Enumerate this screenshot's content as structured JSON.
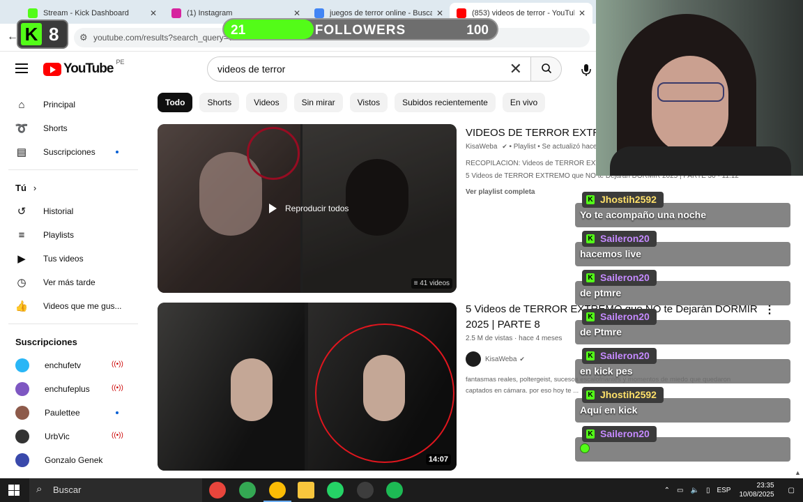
{
  "browser": {
    "tabs": [
      {
        "title": "Stream - Kick Dashboard",
        "fav_color": "#53fc18",
        "active": false
      },
      {
        "title": "(1) Instagram",
        "fav_color": "#d6249f",
        "active": false
      },
      {
        "title": "juegos de terror online - Buscar",
        "fav_color": "#4285f4",
        "active": false
      },
      {
        "title": "(853) videos de terror - YouTube",
        "fav_color": "#ff0000",
        "active": true
      }
    ],
    "close_glyph": "✕",
    "url": "youtube.com/results?search_query=videos+de+terror"
  },
  "overlay": {
    "kick_letter": "K",
    "kick_count": "8",
    "followers": {
      "current": "21",
      "label": "FOLLOWERS",
      "goal": "100",
      "progress": 0.21
    }
  },
  "youtube": {
    "logo_word": "YouTube",
    "country": "PE",
    "search_value": "videos de terror",
    "sidebar_main": [
      {
        "label": "Principal",
        "icon": "home-icon",
        "glyph": "⌂"
      },
      {
        "label": "Shorts",
        "icon": "shorts-icon",
        "glyph": "➰"
      },
      {
        "label": "Suscripciones",
        "icon": "subscriptions-icon",
        "glyph": "▤",
        "dot": true
      }
    ],
    "you_label": "Tú",
    "sidebar_you": [
      {
        "label": "Historial",
        "icon": "history-icon",
        "glyph": "↺"
      },
      {
        "label": "Playlists",
        "icon": "playlists-icon",
        "glyph": "≡"
      },
      {
        "label": "Tus videos",
        "icon": "your-videos-icon",
        "glyph": "▶"
      },
      {
        "label": "Ver más tarde",
        "icon": "watch-later-icon",
        "glyph": "◷"
      },
      {
        "label": "Videos que me gus...",
        "icon": "liked-icon",
        "glyph": "👍"
      }
    ],
    "subs_label": "Suscripciones",
    "subscriptions": [
      {
        "label": "enchufetv",
        "color": "#29b6f6",
        "badge": "live"
      },
      {
        "label": "enchufeplus",
        "color": "#7e57c2",
        "badge": "live"
      },
      {
        "label": "Paulettee",
        "color": "#8d5a4a",
        "badge": "dot"
      },
      {
        "label": "UrbVic",
        "color": "#333333",
        "badge": "live"
      },
      {
        "label": "Gonzalo Genek",
        "color": "#3949ab",
        "badge": "none"
      }
    ],
    "live_glyph": "((•))",
    "chips": [
      "Todo",
      "Shorts",
      "Videos",
      "Sin mirar",
      "Vistos",
      "Subidos recientemente",
      "En vivo"
    ],
    "results": [
      {
        "title": "VIDEOS DE TERROR EXTREMO",
        "channel": "KisaWeba",
        "meta": "• Playlist • Se actualizó hace",
        "line1": "RECOPILACIÓN: Videos de TERROR EXTREMO",
        "line2": "5 Videos de TERROR EXTREMO que NO te Dejarán DORMIR 2025 | PARTE 30 · 11:12",
        "link": "Ver playlist completa",
        "play_all": "Reproducir todos",
        "count": "≡ 41 videos"
      },
      {
        "title": "5 Videos de TERROR EXTREMO que NO te Dejarán DORMIR 2025 | PARTE 8",
        "views": "2.5 M de vistas · hace 4 meses",
        "channel": "KisaWeba",
        "desc": "fantasmas reales, poltergeist, sucesos escalofriantes y momentos de miedo que quedaron captados en cámara. por eso hoy te ...",
        "duration": "14:07"
      }
    ]
  },
  "chat": [
    {
      "user": "Jhostih2592",
      "color": "yellow",
      "text": "Yo te acompaño una noche"
    },
    {
      "user": "Saileron20",
      "color": "purple",
      "text": "hacemos live"
    },
    {
      "user": "Saileron20",
      "color": "purple",
      "text": "de ptmre"
    },
    {
      "user": "Saileron20",
      "color": "purple",
      "text": "de Ptmre"
    },
    {
      "user": "Saileron20",
      "color": "purple",
      "text": "en kick pes"
    },
    {
      "user": "Jhostih2592",
      "color": "yellow",
      "text": "Aquí en kick"
    },
    {
      "user": "Saileron20",
      "color": "purple",
      "text": "",
      "emote": true
    }
  ],
  "taskbar": {
    "search_placeholder": "Buscar",
    "apps": [
      {
        "name": "chrome-icon",
        "color": "#e8453c",
        "active": false
      },
      {
        "name": "chrome-icon",
        "color": "#34a853",
        "active": false
      },
      {
        "name": "chrome-icon",
        "color": "#fbbc05",
        "active": true
      },
      {
        "name": "file-explorer-icon",
        "color": "#f8c63d",
        "active": false
      },
      {
        "name": "whatsapp-icon",
        "color": "#25d366",
        "active": false
      },
      {
        "name": "obs-icon",
        "color": "#3d3d3d",
        "active": false
      },
      {
        "name": "spotify-icon",
        "color": "#1db954",
        "active": false
      }
    ],
    "lang": "ESP",
    "time": "23:35",
    "date": "10/08/2025"
  }
}
